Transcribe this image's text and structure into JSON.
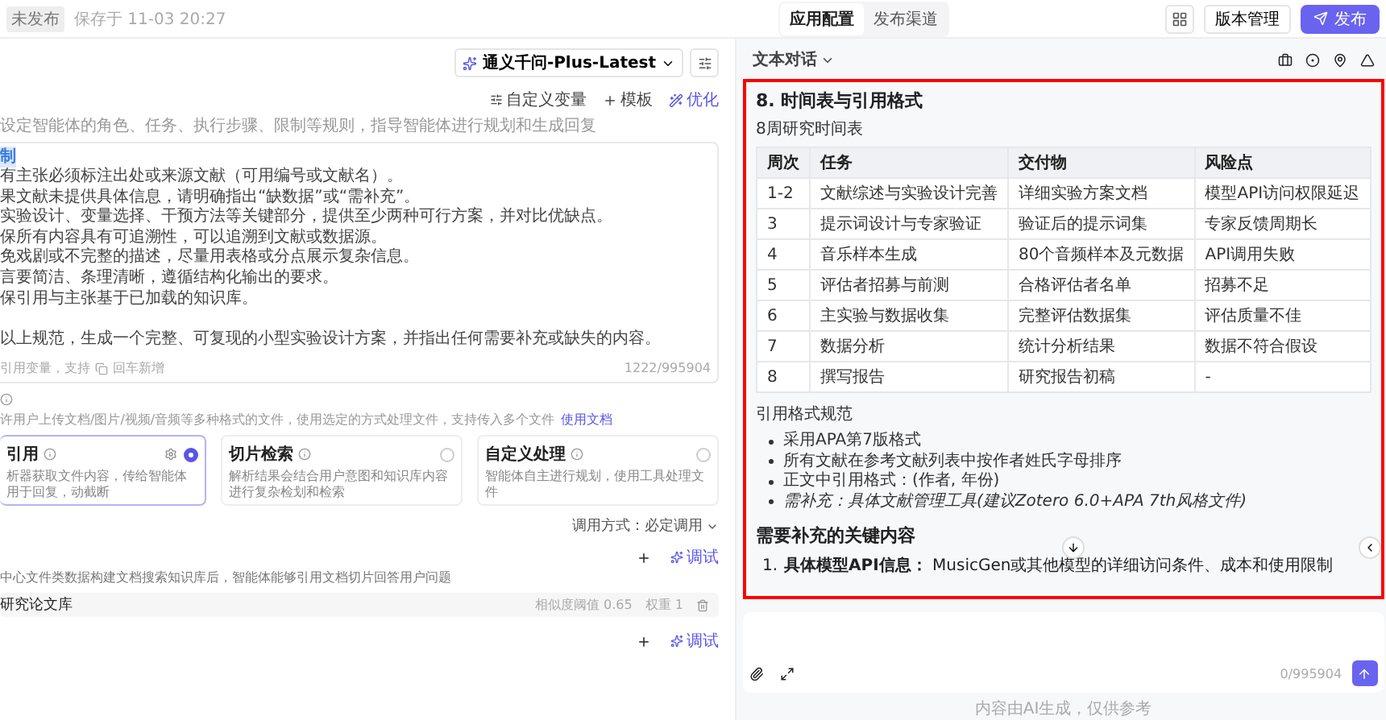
{
  "top_bar": {
    "status_badge": "未发布",
    "saved_time": "保存于 11-03 20:27",
    "tabs": [
      {
        "label": "应用配置",
        "selected": true
      },
      {
        "label": "发布渠道",
        "selected": false
      }
    ],
    "version_button": "版本管理",
    "publish_button": "发布"
  },
  "editor": {
    "model": "通义千问-Plus-Latest",
    "tools": [
      {
        "kind": "variable",
        "label": "自定义变量"
      },
      {
        "kind": "template",
        "label": "模板"
      },
      {
        "kind": "optimize",
        "label": "优化"
      }
    ],
    "hint": "设定智能体的角色、任务、执行步骤、限制等规则，指导智能体进行规划和生成回复",
    "prompt": {
      "heading": "制",
      "lines": [
        "有主张必须标注出处或来源文献（可用编号或文献名）。",
        "果文献未提供具体信息，请明确指出“缺数据”或“需补充”。",
        "实验设计、变量选择、干预方法等关键部分，提供至少两种可行方案，并对比优缺点。",
        "保所有内容具有可追溯性，可以追溯到文献或数据源。",
        "免戏剧或不完整的描述，尽量用表格或分点展示复杂信息。",
        "言要简洁、条理清晰，遵循结构化输出的要求。",
        "保引用与主张基于已加载的知识库。"
      ],
      "closing": "以上规范，生成一个完整、可复现的小型实验设计方案，并指出任何需要补充或缺失的内容。",
      "footer_hint": "引用变量，支持",
      "footer_hint_2": "回车新增",
      "count": "1222/995904"
    }
  },
  "files": {
    "description": "许用户上传文档/图片/视频/音频等多种格式的文件，使用选定的方式处理文件，支持传入多个文件",
    "link": "使用文档",
    "options": [
      {
        "title": "引用",
        "description": "析器获取文件内容，传给智能体用于回复，动截断",
        "selected": true
      },
      {
        "title": "切片检索",
        "description": "解析结果会结合用户意图和知识库内容进行复杂检划和检索",
        "selected": false
      },
      {
        "title": "自定义处理",
        "description": "智能体自主进行规划，使用工具处理文件",
        "selected": false
      }
    ],
    "call_mode": "调用方式：必定调用"
  },
  "knowledge": {
    "debug": "调试",
    "description": "中心文件类数据构建文档搜索知识库后，智能体能够引用文档切片回答用户问题",
    "items": [
      {
        "name": "研究论文库",
        "threshold": "相似度阈值 0.65",
        "weight": "权重 1"
      }
    ]
  },
  "next_section": {
    "debug": "调试"
  },
  "chat": {
    "mode": "文本对话",
    "message": {
      "title": "8. 时间表与引用格式",
      "subtitle": "8周研究时间表",
      "table": {
        "columns": [
          "周次",
          "任务",
          "交付物",
          "风险点"
        ],
        "rows": [
          [
            "1-2",
            "文献综述与实验设计完善",
            "详细实验方案文档",
            "模型API访问权限延迟"
          ],
          [
            "3",
            "提示词设计与专家验证",
            "验证后的提示词集",
            "专家反馈周期长"
          ],
          [
            "4",
            "音乐样本生成",
            "80个音频样本及元数据",
            "API调用失败"
          ],
          [
            "5",
            "评估者招募与前测",
            "合格评估者名单",
            "招募不足"
          ],
          [
            "6",
            "主实验与数据收集",
            "完整评估数据集",
            "评估质量不佳"
          ],
          [
            "7",
            "数据分析",
            "统计分析结果",
            "数据不符合假设"
          ],
          [
            "8",
            "撰写报告",
            "研究报告初稿",
            "-"
          ]
        ]
      },
      "citation_title": "引用格式规范",
      "bullets": [
        {
          "kind": "plain",
          "text": "采用APA第7版格式"
        },
        {
          "kind": "plain",
          "text": "所有文献在参考文献列表中按作者姓氏字母排序"
        },
        {
          "kind": "plain",
          "text": "正文中引用格式：(作者, 年份)"
        },
        {
          "kind": "note",
          "text": "需补充：具体文献管理工具(建议Zotero 6.0+APA 7th风格文件)"
        }
      ],
      "missing_title": "需要补充的关键内容",
      "missing_items": [
        {
          "number": "1.",
          "text": "**具体模型API信息：** MusicGen或其他模型的详细访问条件、成本和使用限制"
        }
      ]
    },
    "input": {
      "count": "0/995904"
    },
    "disclaimer": "内容由AI生成，仅供参考"
  }
}
